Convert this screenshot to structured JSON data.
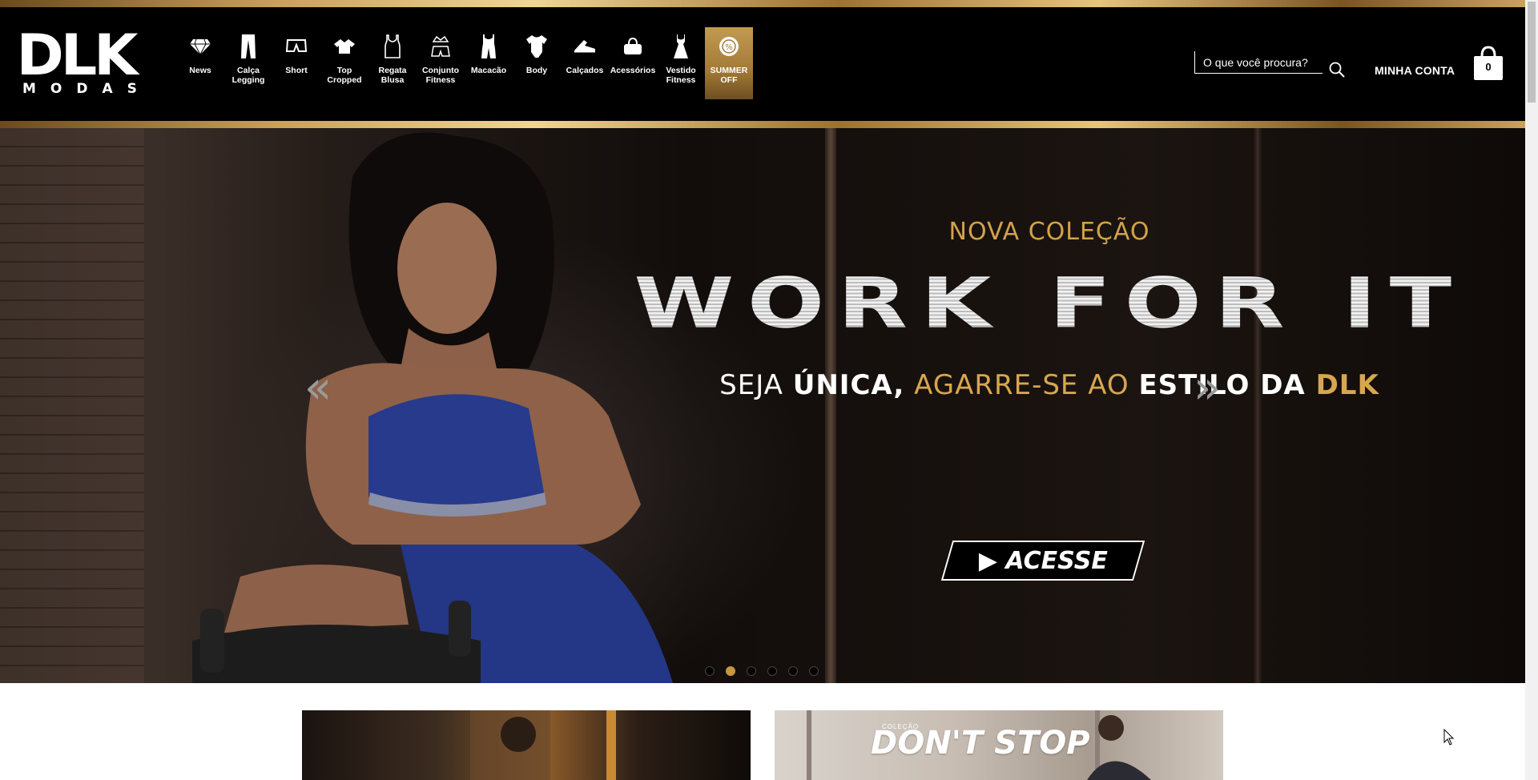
{
  "brand": {
    "logo_letters": "DLK",
    "logo_sub": "MODAS"
  },
  "nav": {
    "categories": [
      {
        "label": "News",
        "icon": "diamond-icon"
      },
      {
        "label": "Calça Legging",
        "icon": "leggings-icon"
      },
      {
        "label": "Short",
        "icon": "shorts-icon"
      },
      {
        "label": "Top Cropped",
        "icon": "top-icon"
      },
      {
        "label": "Regata Blusa",
        "icon": "tank-top-icon"
      },
      {
        "label": "Conjunto Fitness",
        "icon": "outfit-set-icon"
      },
      {
        "label": "Macacão",
        "icon": "jumpsuit-icon"
      },
      {
        "label": "Body",
        "icon": "bodysuit-icon"
      },
      {
        "label": "Calçados",
        "icon": "sneaker-icon"
      },
      {
        "label": "Acessórios",
        "icon": "bag-icon"
      },
      {
        "label": "Vestido Fitness",
        "icon": "dress-icon"
      },
      {
        "label": "SUMMER OFF",
        "icon": "discount-badge-icon"
      }
    ]
  },
  "search": {
    "placeholder": "O que você procura?"
  },
  "account": {
    "label": "MINHA CONTA"
  },
  "cart": {
    "count": "0"
  },
  "hero": {
    "kicker": "NOVA COLEÇÃO",
    "headline": "WORK FOR IT",
    "tagline_1": "SEJA ",
    "tagline_2": "ÚNICA,",
    "tagline_3": " AGARRE-SE AO ",
    "tagline_4": "ESTILO DA ",
    "tagline_5": "DLK",
    "cta": "▶ ACESSE",
    "prev": "«",
    "next": "»",
    "slides": 6,
    "active_slide": 2
  },
  "banners": [
    {
      "label": "",
      "title": ""
    },
    {
      "label": "COLEÇÃO",
      "title": "DON'T STOP"
    }
  ],
  "colors": {
    "gold": "#c7983f",
    "background": "#000000"
  }
}
